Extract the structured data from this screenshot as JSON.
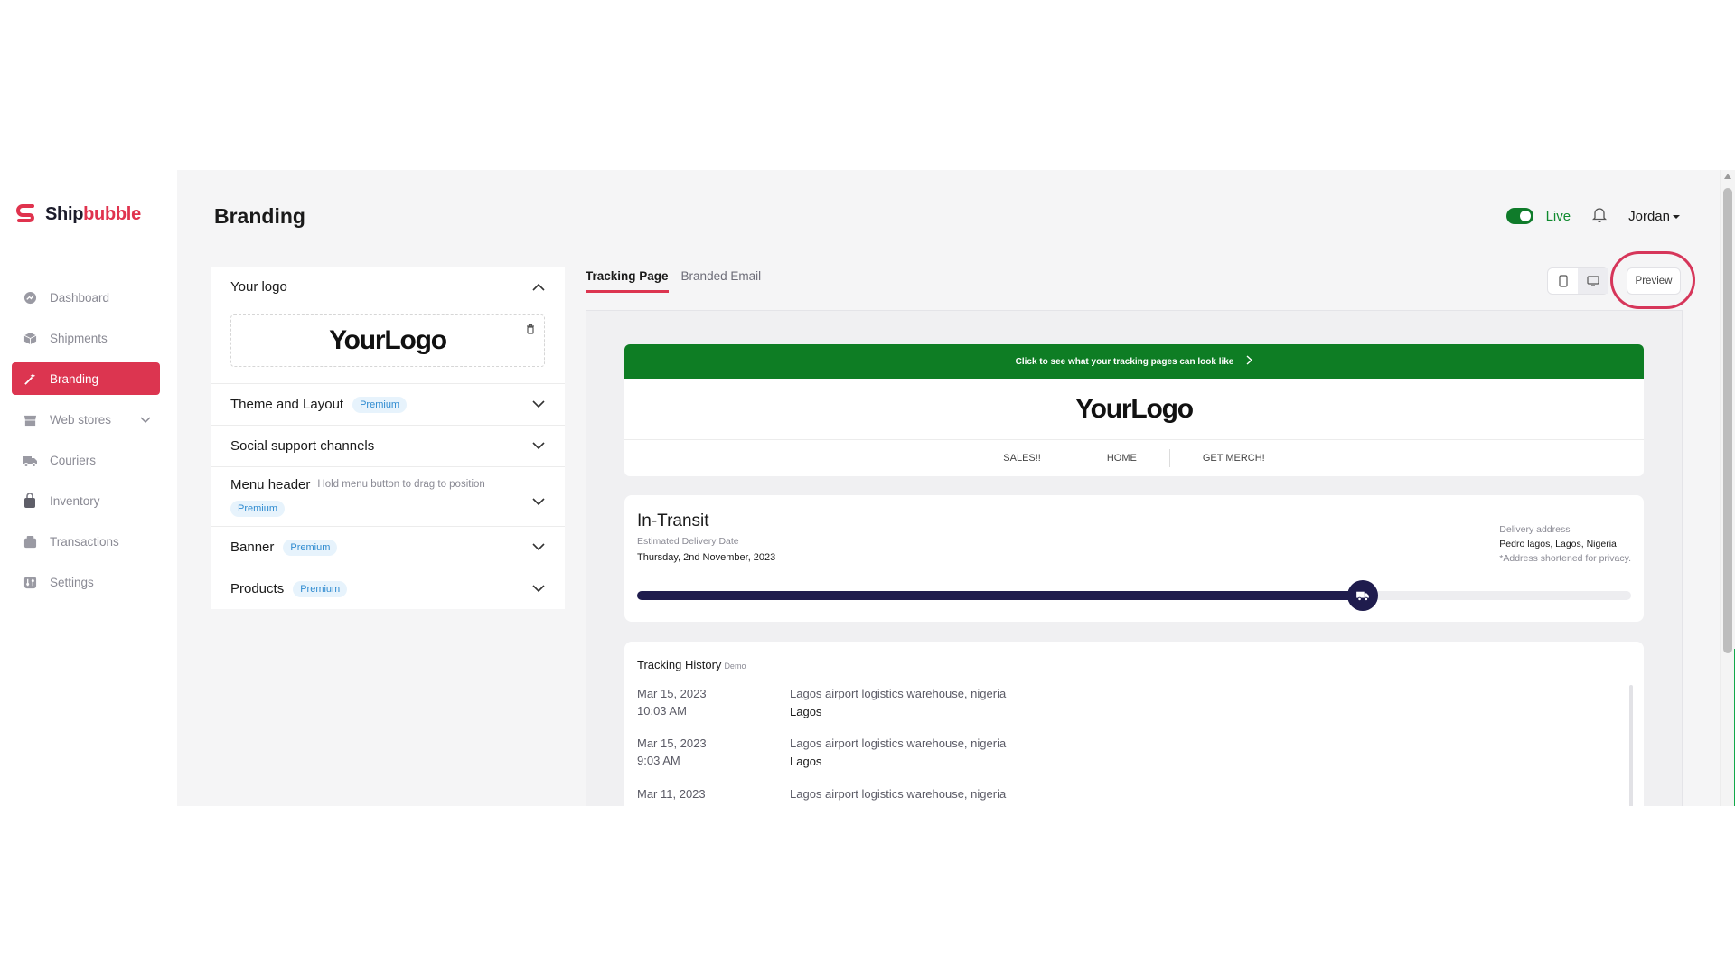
{
  "brand": {
    "name_part1": "Ship",
    "name_part2": "bubble",
    "color": "#e0334e"
  },
  "sidebar": {
    "items": [
      {
        "label": "Dashboard",
        "icon": "dashboard-icon"
      },
      {
        "label": "Shipments",
        "icon": "box-icon"
      },
      {
        "label": "Branding",
        "icon": "magic-wand-icon",
        "active": true
      },
      {
        "label": "Web stores",
        "icon": "store-icon"
      },
      {
        "label": "Couriers",
        "icon": "truck-icon"
      },
      {
        "label": "Inventory",
        "icon": "inventory-icon"
      },
      {
        "label": "Transactions",
        "icon": "wallet-icon"
      },
      {
        "label": "Settings",
        "icon": "settings-icon"
      }
    ]
  },
  "header": {
    "title": "Branding",
    "live_label": "Live",
    "user": "Jordan"
  },
  "settings": {
    "your_logo": "Your logo",
    "logo_text": "YourLogo",
    "theme": "Theme and Layout",
    "social": "Social support channels",
    "menu_header": "Menu header",
    "menu_hint": "Hold menu button to drag to position",
    "banner": "Banner",
    "products": "Products",
    "premium": "Premium"
  },
  "tabs": [
    {
      "label": "Tracking Page",
      "active": true
    },
    {
      "label": "Branded Email"
    }
  ],
  "preview_button": "Preview",
  "preview": {
    "banner_text": "Click to see what your tracking pages can look like",
    "logo_text": "YourLogo",
    "menu": [
      "SALES!!",
      "HOME",
      "GET MERCH!"
    ],
    "status": "In-Transit",
    "est_label": "Estimated Delivery Date",
    "est_date": "Thursday, 2nd November, 2023",
    "addr_label": "Delivery address",
    "addr_value": "Pedro lagos, Lagos, Nigeria",
    "addr_note": "*Address shortened for privacy.",
    "progress": 0.73,
    "history_title": "Tracking History",
    "history_tag": "Demo",
    "history": [
      {
        "date": "Mar 15, 2023",
        "time": "10:03 AM",
        "desc": "Lagos airport logistics warehouse, nigeria",
        "loc": "Lagos"
      },
      {
        "date": "Mar 15, 2023",
        "time": "9:03 AM",
        "desc": "Lagos airport logistics warehouse, nigeria",
        "loc": "Lagos"
      },
      {
        "date": "Mar 11, 2023",
        "time": "",
        "desc": "Lagos airport logistics warehouse, nigeria",
        "loc": ""
      }
    ]
  },
  "colors": {
    "accent": "#dc3550",
    "live_green": "#0f7b2a",
    "banner_green": "#0e7d24",
    "progress": "#1f1c4d"
  }
}
